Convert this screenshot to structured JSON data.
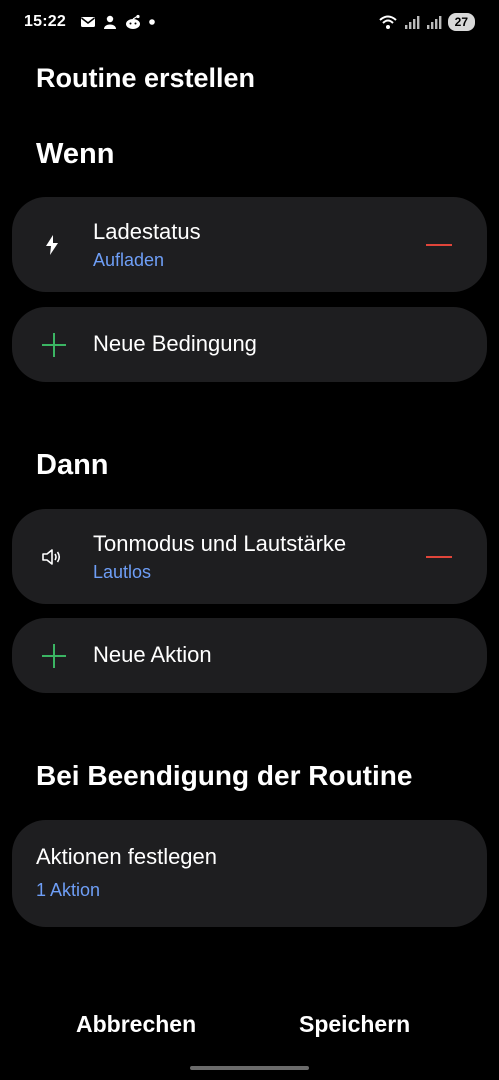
{
  "status_bar": {
    "time": "15:22",
    "battery": "27",
    "left_icons": [
      "mail-icon",
      "notification-icon",
      "reddit-icon",
      "dot-icon"
    ],
    "right_icons": [
      "wifi-icon",
      "signal-icon",
      "signal-icon"
    ]
  },
  "page": {
    "title": "Routine erstellen"
  },
  "wenn": {
    "title": "Wenn",
    "condition": {
      "title": "Ladestatus",
      "subtitle": "Aufladen",
      "icon": "lightning-icon"
    },
    "add_label": "Neue Bedingung"
  },
  "dann": {
    "title": "Dann",
    "action": {
      "title": "Tonmodus und Lautstärke",
      "subtitle": "Lautlos",
      "icon": "speaker-icon"
    },
    "add_label": "Neue Aktion"
  },
  "end": {
    "title": "Bei Beendigung der Routine",
    "card_title": "Aktionen festlegen",
    "card_subtitle": "1 Aktion"
  },
  "buttons": {
    "cancel": "Abbrechen",
    "save": "Speichern"
  },
  "colors": {
    "background": "#000000",
    "card": "#1e1e20",
    "accent_blue": "#6e9ef6",
    "plus_green": "#3bb563",
    "remove_red": "#e0453a"
  }
}
